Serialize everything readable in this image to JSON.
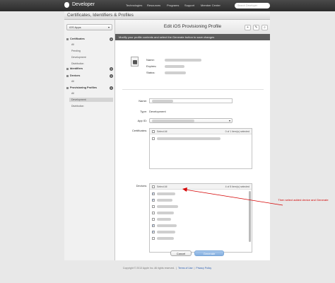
{
  "topnav": {
    "brand": "Developer",
    "items": [
      "Technologies",
      "Resources",
      "Programs",
      "Support",
      "Member Center"
    ],
    "search_placeholder": "Search Developer"
  },
  "header": {
    "title": "Certificates, Identifiers & Profiles"
  },
  "sidebar": {
    "platform": "iOS Apps",
    "sections": [
      {
        "label": "Certificates",
        "items": [
          "All",
          "Pending",
          "Development",
          "Distribution"
        ]
      },
      {
        "label": "Identifiers",
        "items": []
      },
      {
        "label": "Devices",
        "items": [
          "All"
        ]
      },
      {
        "label": "Provisioning Profiles",
        "items": [
          "All",
          "Development",
          "Distribution"
        ]
      }
    ],
    "active_item": "Development"
  },
  "panel": {
    "title": "Edit iOS Provisioning Profile",
    "subtitle": "Modify your profile contents and select the Generate button to save changes",
    "profile_icon_text": "PROV",
    "summary_labels": [
      "Name:",
      "Expires:",
      "Status:"
    ],
    "form": {
      "name_label": "Name:",
      "type_label": "Type:",
      "type_value": "Development",
      "appid_label": "App ID:",
      "certs_label": "Certificates:",
      "certs_select_all": "Select All",
      "certs_count": "0 of 1 item(s) selected",
      "devices_label": "Devices:",
      "devices_select_all": "Select All",
      "devices_count": "4 of 8 item(s) selected",
      "device_checks": [
        true,
        true,
        false,
        false,
        false,
        true,
        true,
        false
      ]
    },
    "buttons": {
      "cancel": "Cancel",
      "generate": "Generate"
    }
  },
  "footer": {
    "copyright": "Copyright © 2013 Apple Inc. All rights reserved.",
    "terms": "Terms of Use",
    "privacy": "Privacy Policy"
  },
  "annotation": {
    "text": "Then select added device and Generate",
    "color": "#d40000"
  }
}
